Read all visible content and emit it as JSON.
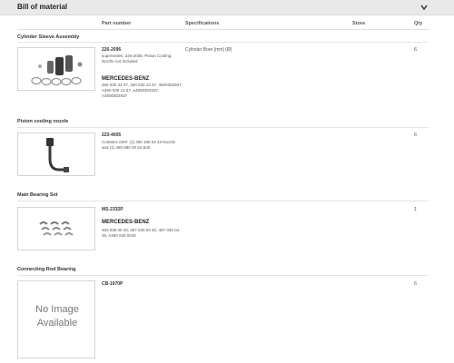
{
  "header": {
    "title": "Bill of material"
  },
  "columns": {
    "part_number": "Part number",
    "specifications": "Specifications",
    "sizes": "Sizes",
    "qty": "Qty"
  },
  "items": [
    {
      "section": "Cylinder Sleeve Assembly",
      "part_number": "226-2096",
      "note": "supersedes: 226-2036, Piston Cooling Nozzle not Included",
      "brand": "MERCEDES-BENZ",
      "refs": "460 030 33 37, 460 030 13 37, 4600302937, A460 030 13 37, A4600303337, A4600302937",
      "spec": "Cylinder Bore [mm] (Ø)",
      "qty": "6",
      "image_icon": "cylinder-sleeve-kit-icon"
    },
    {
      "section": "Piston cooling nozzle",
      "part_number": "223-4005",
      "note": "Contains OE#: (1) 460 180 03 43 Nozzle and (1) 460 990 00 63 Bolt",
      "brand": "",
      "refs": "",
      "spec": "",
      "qty": "6",
      "image_icon": "cooling-nozzle-icon"
    },
    {
      "section": "Main Bearing Set",
      "part_number": "MS-2332P",
      "note": "",
      "brand": "MERCEDES-BENZ",
      "refs": "460 030 00 40, 457 030 03 40, 457 030 04 45, A460 030 0040",
      "spec": "",
      "qty": "1",
      "image_icon": "bearing-shells-icon"
    },
    {
      "section": "Connecting Rod Bearing",
      "part_number": "CB-1970P",
      "note": "",
      "brand": "",
      "refs": "",
      "spec": "",
      "qty": "6",
      "image_icon": "no-image-placeholder",
      "no_image_text_line1": "No Image",
      "no_image_text_line2": "Available"
    }
  ]
}
